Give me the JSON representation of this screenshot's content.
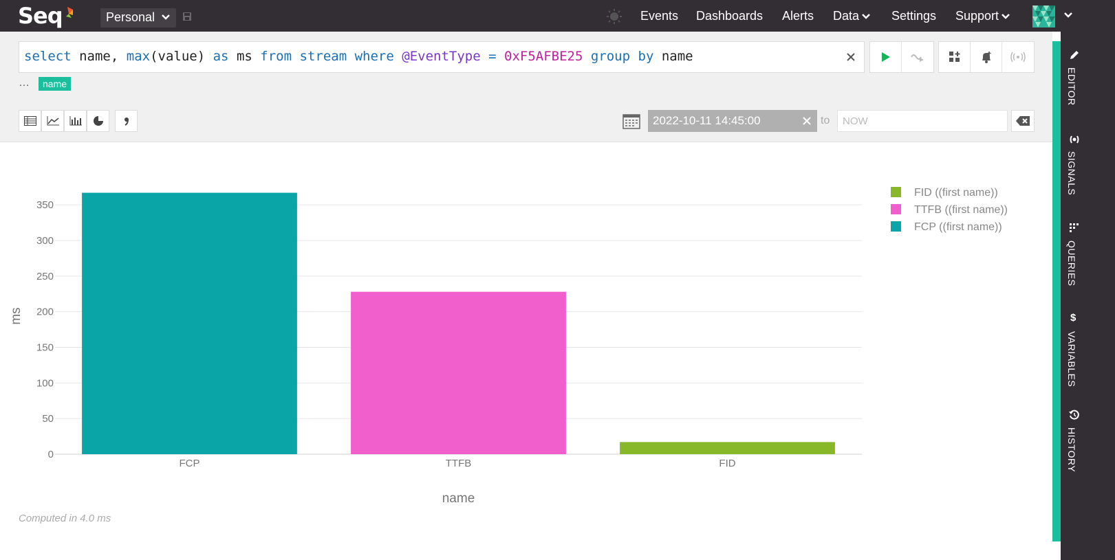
{
  "app": {
    "logo_text": "Seq",
    "workspace": "Personal"
  },
  "nav": {
    "events": "Events",
    "dashboards": "Dashboards",
    "alerts": "Alerts",
    "data": "Data",
    "settings": "Settings",
    "support": "Support"
  },
  "query": {
    "tokens": [
      "select",
      "name,",
      "max",
      "(value)",
      "as",
      "ms",
      "from",
      "stream",
      "where",
      "@EventType",
      "=",
      "0xF5AFBE25",
      "group",
      "by",
      "name"
    ],
    "column_tag": "name",
    "ellipsis": "…"
  },
  "range": {
    "from": "2022-10-11 14:45:00",
    "to_label": "to",
    "until_placeholder": "NOW"
  },
  "chart_data": {
    "type": "bar",
    "categories": [
      "FCP",
      "TTFB",
      "FID"
    ],
    "values": [
      367,
      228,
      17
    ],
    "colors": [
      "#0aa5a6",
      "#f15fcc",
      "#86b82a"
    ],
    "xlabel": "name",
    "ylabel": "ms",
    "ylim": [
      0,
      380
    ],
    "yticks": [
      0,
      50,
      100,
      150,
      200,
      250,
      300,
      350
    ],
    "grid": true,
    "legend_position": "top-right",
    "legend": [
      {
        "name": "FID ((first name))",
        "color": "#86b82a"
      },
      {
        "name": "TTFB ((first name))",
        "color": "#f15fcc"
      },
      {
        "name": "FCP ((first name))",
        "color": "#0aa5a6"
      }
    ]
  },
  "footer": {
    "computed": "Computed in 4.0 ms"
  },
  "sidebar": {
    "editor": "EDITOR",
    "signals": "SIGNALS",
    "queries": "QUERIES",
    "variables": "VARIABLES",
    "history": "HISTORY"
  }
}
